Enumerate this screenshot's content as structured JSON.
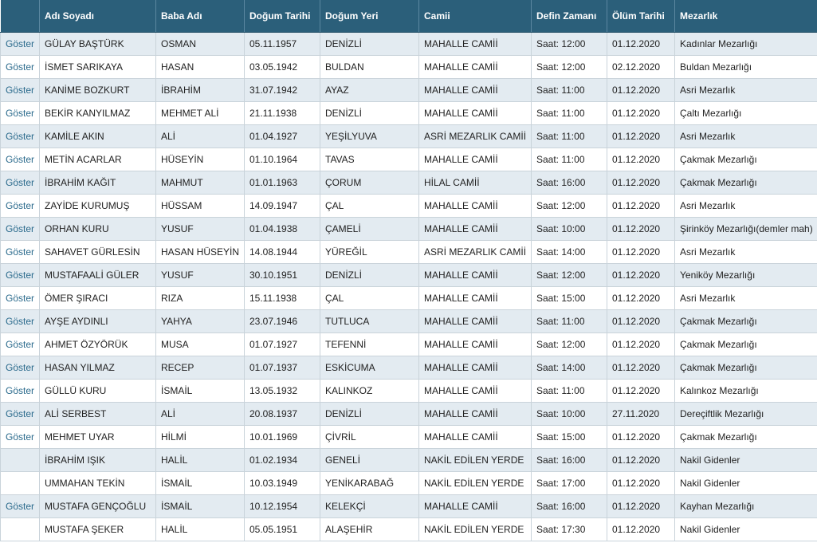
{
  "headers": [
    "",
    "Adı Soyadı",
    "Baba Adı",
    "Doğum Tarihi",
    "Doğum Yeri",
    "Camii",
    "Defin Zamanı",
    "Ölüm Tarihi",
    "Mezarlık"
  ],
  "link_label": "Göster",
  "rows": [
    {
      "link": "Göster",
      "name": "GÜLAY BAŞTÜRK",
      "father": "OSMAN",
      "birth_date": "05.11.1957",
      "birth_place": "DENİZLİ",
      "mosque": "MAHALLE CAMİİ",
      "burial_time": "Saat: 12:00",
      "death_date": "01.12.2020",
      "cemetery": "Kadınlar Mezarlığı"
    },
    {
      "link": "Göster",
      "name": "İSMET SARIKAYA",
      "father": "HASAN",
      "birth_date": "03.05.1942",
      "birth_place": "BULDAN",
      "mosque": "MAHALLE CAMİİ",
      "burial_time": "Saat: 12:00",
      "death_date": "02.12.2020",
      "cemetery": "Buldan Mezarlığı"
    },
    {
      "link": "Göster",
      "name": "KANİME BOZKURT",
      "father": "İBRAHİM",
      "birth_date": "31.07.1942",
      "birth_place": "AYAZ",
      "mosque": "MAHALLE CAMİİ",
      "burial_time": "Saat: 11:00",
      "death_date": "01.12.2020",
      "cemetery": "Asri Mezarlık"
    },
    {
      "link": "Göster",
      "name": "BEKİR KANYILMAZ",
      "father": "MEHMET ALİ",
      "birth_date": "21.11.1938",
      "birth_place": "DENİZLİ",
      "mosque": "MAHALLE CAMİİ",
      "burial_time": "Saat: 11:00",
      "death_date": "01.12.2020",
      "cemetery": "Çaltı Mezarlığı"
    },
    {
      "link": "Göster",
      "name": "KAMİLE AKIN",
      "father": "ALİ",
      "birth_date": "01.04.1927",
      "birth_place": "YEŞİLYUVA",
      "mosque": "ASRİ MEZARLIK CAMİİ",
      "burial_time": "Saat: 11:00",
      "death_date": "01.12.2020",
      "cemetery": "Asri Mezarlık"
    },
    {
      "link": "Göster",
      "name": "METİN ACARLAR",
      "father": "HÜSEYİN",
      "birth_date": "01.10.1964",
      "birth_place": "TAVAS",
      "mosque": "MAHALLE CAMİİ",
      "burial_time": "Saat: 11:00",
      "death_date": "01.12.2020",
      "cemetery": "Çakmak Mezarlığı"
    },
    {
      "link": "Göster",
      "name": "İBRAHİM KAĞIT",
      "father": "MAHMUT",
      "birth_date": "01.01.1963",
      "birth_place": "ÇORUM",
      "mosque": "HİLAL CAMİİ",
      "burial_time": "Saat: 16:00",
      "death_date": "01.12.2020",
      "cemetery": "Çakmak Mezarlığı"
    },
    {
      "link": "Göster",
      "name": "ZAYİDE KURUMUŞ",
      "father": "HÜSSAM",
      "birth_date": "14.09.1947",
      "birth_place": "ÇAL",
      "mosque": "MAHALLE CAMİİ",
      "burial_time": "Saat: 12:00",
      "death_date": "01.12.2020",
      "cemetery": "Asri Mezarlık"
    },
    {
      "link": "Göster",
      "name": "ORHAN KURU",
      "father": "YUSUF",
      "birth_date": "01.04.1938",
      "birth_place": "ÇAMELİ",
      "mosque": "MAHALLE CAMİİ",
      "burial_time": "Saat: 10:00",
      "death_date": "01.12.2020",
      "cemetery": "Şirinköy Mezarlığı(demler mah)"
    },
    {
      "link": "Göster",
      "name": "SAHAVET GÜRLESİN",
      "father": "HASAN HÜSEYİN",
      "birth_date": "14.08.1944",
      "birth_place": "YÜREĞİL",
      "mosque": "ASRİ MEZARLIK CAMİİ",
      "burial_time": "Saat: 14:00",
      "death_date": "01.12.2020",
      "cemetery": "Asri Mezarlık"
    },
    {
      "link": "Göster",
      "name": "MUSTAFAALİ GÜLER",
      "father": "YUSUF",
      "birth_date": "30.10.1951",
      "birth_place": "DENİZLİ",
      "mosque": "MAHALLE CAMİİ",
      "burial_time": "Saat: 12:00",
      "death_date": "01.12.2020",
      "cemetery": "Yeniköy Mezarlığı"
    },
    {
      "link": "Göster",
      "name": "ÖMER ŞIRACI",
      "father": "RIZA",
      "birth_date": "15.11.1938",
      "birth_place": "ÇAL",
      "mosque": "MAHALLE CAMİİ",
      "burial_time": "Saat: 15:00",
      "death_date": "01.12.2020",
      "cemetery": "Asri Mezarlık"
    },
    {
      "link": "Göster",
      "name": "AYŞE AYDINLI",
      "father": "YAHYA",
      "birth_date": "23.07.1946",
      "birth_place": "TUTLUCA",
      "mosque": "MAHALLE CAMİİ",
      "burial_time": "Saat: 11:00",
      "death_date": "01.12.2020",
      "cemetery": "Çakmak Mezarlığı"
    },
    {
      "link": "Göster",
      "name": "AHMET ÖZYÖRÜK",
      "father": "MUSA",
      "birth_date": "01.07.1927",
      "birth_place": "TEFENNİ",
      "mosque": "MAHALLE CAMİİ",
      "burial_time": "Saat: 12:00",
      "death_date": "01.12.2020",
      "cemetery": "Çakmak Mezarlığı"
    },
    {
      "link": "Göster",
      "name": "HASAN YILMAZ",
      "father": "RECEP",
      "birth_date": "01.07.1937",
      "birth_place": "ESKİCUMA",
      "mosque": "MAHALLE CAMİİ",
      "burial_time": "Saat: 14:00",
      "death_date": "01.12.2020",
      "cemetery": "Çakmak Mezarlığı"
    },
    {
      "link": "Göster",
      "name": "GÜLLÜ KURU",
      "father": "İSMAİL",
      "birth_date": "13.05.1932",
      "birth_place": "KALINKOZ",
      "mosque": "MAHALLE CAMİİ",
      "burial_time": "Saat: 11:00",
      "death_date": "01.12.2020",
      "cemetery": "Kalınkoz Mezarlığı"
    },
    {
      "link": "Göster",
      "name": "ALİ SERBEST",
      "father": "ALİ",
      "birth_date": "20.08.1937",
      "birth_place": "DENİZLİ",
      "mosque": "MAHALLE CAMİİ",
      "burial_time": "Saat: 10:00",
      "death_date": "27.11.2020",
      "cemetery": "Dereçiftlik Mezarlığı"
    },
    {
      "link": "Göster",
      "name": "MEHMET UYAR",
      "father": "HİLMİ",
      "birth_date": "10.01.1969",
      "birth_place": "ÇİVRİL",
      "mosque": "MAHALLE CAMİİ",
      "burial_time": "Saat: 15:00",
      "death_date": "01.12.2020",
      "cemetery": "Çakmak Mezarlığı"
    },
    {
      "link": "",
      "name": "İBRAHİM IŞIK",
      "father": "HALİL",
      "birth_date": "01.02.1934",
      "birth_place": "GENELİ",
      "mosque": "NAKİL EDİLEN YERDE",
      "burial_time": "Saat: 16:00",
      "death_date": "01.12.2020",
      "cemetery": "Nakil Gidenler"
    },
    {
      "link": "",
      "name": "UMMAHAN TEKİN",
      "father": "İSMAİL",
      "birth_date": "10.03.1949",
      "birth_place": "YENİKARABAĞ",
      "mosque": "NAKİL EDİLEN YERDE",
      "burial_time": "Saat: 17:00",
      "death_date": "01.12.2020",
      "cemetery": "Nakil Gidenler"
    },
    {
      "link": "Göster",
      "name": "MUSTAFA GENÇOĞLU",
      "father": "İSMAİL",
      "birth_date": "10.12.1954",
      "birth_place": "KELEKÇİ",
      "mosque": "MAHALLE CAMİİ",
      "burial_time": "Saat: 16:00",
      "death_date": "01.12.2020",
      "cemetery": "Kayhan Mezarlığı"
    },
    {
      "link": "",
      "name": "MUSTAFA ŞEKER",
      "father": "HALİL",
      "birth_date": "05.05.1951",
      "birth_place": "ALAŞEHİR",
      "mosque": "NAKİL EDİLEN YERDE",
      "burial_time": "Saat: 17:30",
      "death_date": "01.12.2020",
      "cemetery": "Nakil Gidenler"
    }
  ]
}
